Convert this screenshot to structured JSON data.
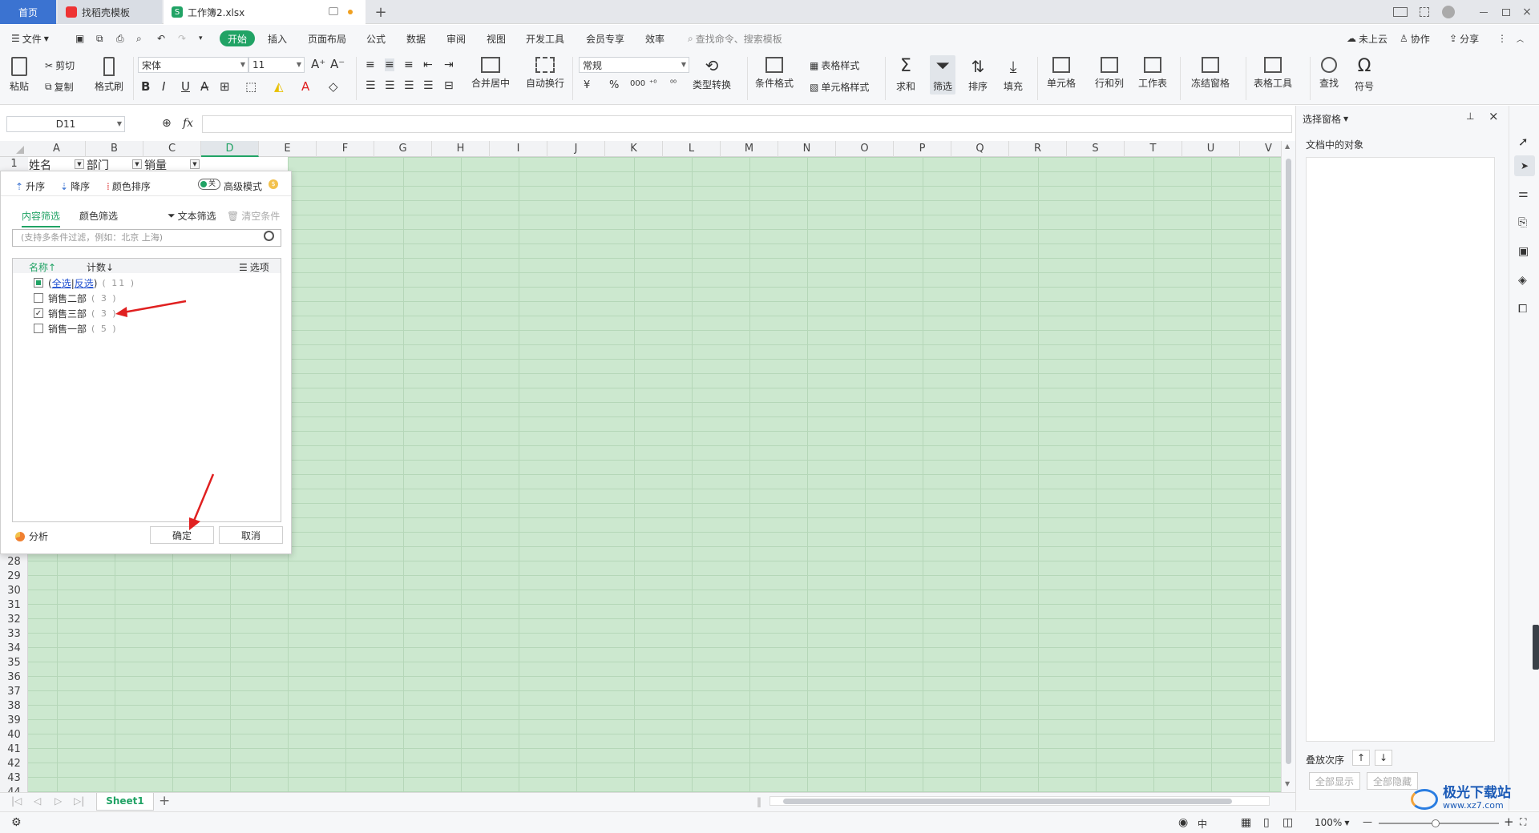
{
  "tabs": {
    "home": "首页",
    "daoke": "找稻壳模板",
    "book": "工作簿2.xlsx"
  },
  "menu": {
    "file": "文件",
    "start": "开始",
    "insert": "插入",
    "layout": "页面布局",
    "formula": "公式",
    "data": "数据",
    "review": "审阅",
    "view": "视图",
    "dev": "开发工具",
    "member": "会员专享",
    "efficiency": "效率",
    "search": "查找命令、搜索模板",
    "cloud": "未上云",
    "collab": "协作",
    "share": "分享"
  },
  "ribbon": {
    "paste": "粘贴",
    "cut": "剪切",
    "copy": "复制",
    "format_painter": "格式刷",
    "font": "宋体",
    "size": "11",
    "merge": "合并居中",
    "wrap": "自动换行",
    "number_format": "常规",
    "convert": "类型转换",
    "cond_format": "条件格式",
    "table_style": "表格样式",
    "cell_style": "单元格样式",
    "sum": "求和",
    "filter": "筛选",
    "sort": "排序",
    "fill": "填充",
    "cell": "单元格",
    "rowcol": "行和列",
    "worksheet": "工作表",
    "freeze": "冻结窗格",
    "table_tools": "表格工具",
    "find": "查找",
    "symbol": "符号"
  },
  "formula_bar": {
    "cell_ref": "D11",
    "fx": "fx",
    "value": ""
  },
  "columns": [
    "A",
    "B",
    "C",
    "D",
    "E",
    "F",
    "G",
    "H",
    "I",
    "J",
    "K",
    "L",
    "M",
    "N",
    "O",
    "P",
    "Q",
    "R",
    "S",
    "T",
    "U",
    "V"
  ],
  "header_row": {
    "num": "1",
    "a": "姓名",
    "b": "部门",
    "c": "销量"
  },
  "row_numbers": [
    "28",
    "29",
    "30",
    "31",
    "32",
    "33",
    "34",
    "35",
    "36",
    "37",
    "38",
    "39",
    "40",
    "41",
    "42",
    "43",
    "44"
  ],
  "filter": {
    "asc": "升序",
    "desc": "降序",
    "color_sort": "颜色排序",
    "advanced": "高级模式",
    "toggle_off": "关",
    "tab_content": "内容筛选",
    "tab_color": "颜色筛选",
    "text_filter": "文本筛选",
    "clear": "清空条件",
    "search_placeholder": "(支持多条件过滤，例如：北京 上海)",
    "col_name": "名称↑",
    "col_count": "计数↓",
    "options": "选项",
    "select_all": "全选",
    "invert": "反选",
    "all_count": "11",
    "items": [
      {
        "label": "销售二部",
        "count": "3",
        "checked": false
      },
      {
        "label": "销售三部",
        "count": "3",
        "checked": true
      },
      {
        "label": "销售一部",
        "count": "5",
        "checked": false
      }
    ],
    "analysis": "分析",
    "ok": "确定",
    "cancel": "取消"
  },
  "right_pane": {
    "title": "选择窗格",
    "objects": "文档中的对象",
    "order": "叠放次序",
    "show_all": "全部显示",
    "hide_all": "全部隐藏"
  },
  "sheet": {
    "name": "Sheet1"
  },
  "status": {
    "zoom": "100%",
    "ime": "中"
  },
  "watermark": {
    "text": "极光下载站",
    "url": "www.xz7.com"
  },
  "colors": {
    "accent": "#21a365",
    "tab_blue": "#3b73d1",
    "grid_fill": "#cce8cf",
    "arrow": "#e02020"
  }
}
